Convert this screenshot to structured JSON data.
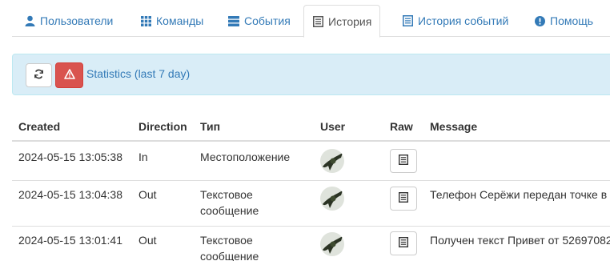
{
  "tabs": [
    {
      "label": "Пользователи",
      "icon": "user-icon"
    },
    {
      "label": "Команды",
      "icon": "grid-icon"
    },
    {
      "label": "События",
      "icon": "server-icon"
    },
    {
      "label": "История",
      "icon": "list-icon",
      "active": true
    },
    {
      "label": "История событий",
      "icon": "list-icon"
    },
    {
      "label": "Помощь",
      "icon": "info-icon"
    }
  ],
  "toolbar": {
    "statistics_label": "Statistics (last 7 day)"
  },
  "colors": {
    "link": "#337ab7",
    "alert_bg": "#d9edf7",
    "danger": "#d9534f"
  },
  "table": {
    "headers": [
      "Created",
      "Direction",
      "Тип",
      "User",
      "Raw",
      "Message"
    ],
    "rows": [
      {
        "created": "2024-05-15 13:05:38",
        "direction": "In",
        "type_line1": "Местоположение",
        "type_line2": "",
        "message": ""
      },
      {
        "created": "2024-05-15 13:04:38",
        "direction": "Out",
        "type_line1": "Текстовое",
        "type_line2": "сообщение",
        "message": "Телефон Серёжи передан точке в"
      },
      {
        "created": "2024-05-15 13:01:41",
        "direction": "Out",
        "type_line1": "Текстовое",
        "type_line2": "сообщение",
        "message": "Получен текст Привет от 52697082"
      }
    ]
  }
}
